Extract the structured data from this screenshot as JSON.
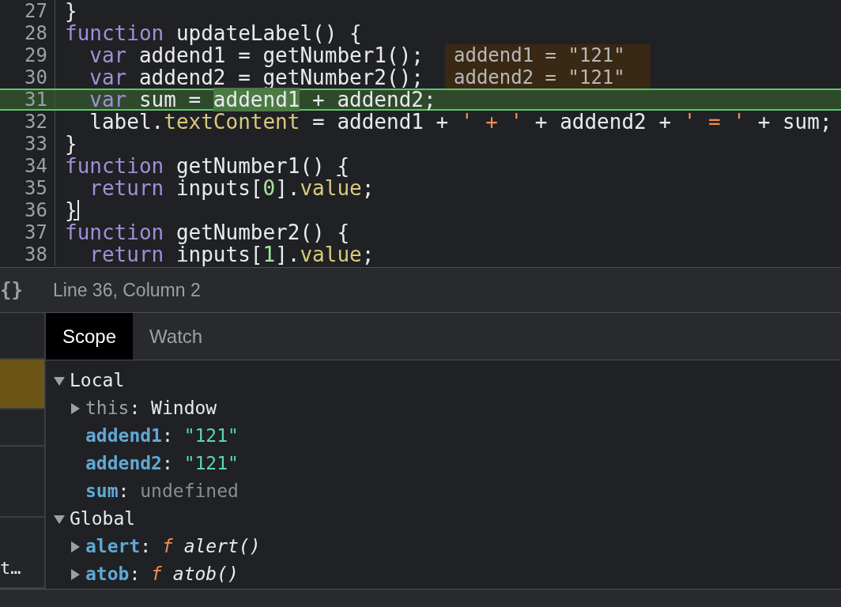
{
  "editor": {
    "lines": [
      {
        "number": "27",
        "current": false,
        "cursor": false,
        "tokens": [
          {
            "kind": "plain",
            "text": "}"
          }
        ]
      },
      {
        "number": "28",
        "current": false,
        "cursor": false,
        "tokens": [
          {
            "kind": "keyword",
            "text": "function"
          },
          {
            "kind": "plain",
            "text": " updateLabel() {"
          }
        ]
      },
      {
        "number": "29",
        "current": false,
        "cursor": false,
        "tokens": [
          {
            "kind": "keyword",
            "text": "  var"
          },
          {
            "kind": "plain",
            "text": " addend1 = getNumber1();"
          }
        ],
        "inline_value": "addend1 = \"121\""
      },
      {
        "number": "30",
        "current": false,
        "cursor": false,
        "tokens": [
          {
            "kind": "keyword",
            "text": "  var"
          },
          {
            "kind": "plain",
            "text": " addend2 = getNumber2();"
          }
        ],
        "inline_value": "addend2 = \"121\""
      },
      {
        "number": "31",
        "current": true,
        "cursor": false,
        "tokens": [
          {
            "kind": "keyword",
            "text": "  var"
          },
          {
            "kind": "plain",
            "text": " sum = "
          },
          {
            "kind": "plain",
            "text": "addend1",
            "hovered": true
          },
          {
            "kind": "plain",
            "text": " + addend2;"
          }
        ]
      },
      {
        "number": "32",
        "current": false,
        "cursor": false,
        "tokens": [
          {
            "kind": "plain",
            "text": "  label."
          },
          {
            "kind": "property",
            "text": "textContent"
          },
          {
            "kind": "plain",
            "text": " = addend1 + "
          },
          {
            "kind": "string",
            "text": "' + '"
          },
          {
            "kind": "plain",
            "text": " + addend2 + "
          },
          {
            "kind": "string",
            "text": "' = '"
          },
          {
            "kind": "plain",
            "text": " + sum;"
          }
        ]
      },
      {
        "number": "33",
        "current": false,
        "cursor": false,
        "tokens": [
          {
            "kind": "plain",
            "text": "}"
          }
        ]
      },
      {
        "number": "34",
        "current": false,
        "cursor": false,
        "tokens": [
          {
            "kind": "keyword",
            "text": "function"
          },
          {
            "kind": "plain",
            "text": " getNumber1() "
          },
          {
            "kind": "plain",
            "text": "{",
            "matched": true
          }
        ]
      },
      {
        "number": "35",
        "current": false,
        "cursor": false,
        "tokens": [
          {
            "kind": "keyword",
            "text": "  return"
          },
          {
            "kind": "plain",
            "text": " inputs["
          },
          {
            "kind": "number",
            "text": "0"
          },
          {
            "kind": "plain",
            "text": "]."
          },
          {
            "kind": "property",
            "text": "value"
          },
          {
            "kind": "plain",
            "text": ";"
          }
        ]
      },
      {
        "number": "36",
        "current": false,
        "cursor": true,
        "tokens": [
          {
            "kind": "plain",
            "text": "}",
            "matched": true
          }
        ]
      },
      {
        "number": "37",
        "current": false,
        "cursor": false,
        "tokens": [
          {
            "kind": "keyword",
            "text": "function"
          },
          {
            "kind": "plain",
            "text": " getNumber2() {"
          }
        ]
      },
      {
        "number": "38",
        "current": false,
        "cursor": false,
        "tokens": [
          {
            "kind": "keyword",
            "text": "  return"
          },
          {
            "kind": "plain",
            "text": " inputs["
          },
          {
            "kind": "number",
            "text": "1"
          },
          {
            "kind": "plain",
            "text": "]."
          },
          {
            "kind": "property",
            "text": "value"
          },
          {
            "kind": "plain",
            "text": ";"
          }
        ]
      }
    ]
  },
  "status_bar": {
    "icon": "{}",
    "position": "Line 36, Column 2"
  },
  "sidebar": {
    "items": [
      {
        "selected": false
      },
      {
        "selected": true
      },
      {
        "selected": false
      },
      {
        "selected": false
      },
      {
        "selected": false,
        "text": "t…"
      }
    ]
  },
  "tabs": [
    {
      "label": "Scope",
      "selected": true
    },
    {
      "label": "Watch",
      "selected": false
    }
  ],
  "scope": [
    {
      "label": "Local",
      "expanded": true,
      "children": [
        {
          "name": "this",
          "colon": ":",
          "kind": "object",
          "value": "Window",
          "expanded": false
        },
        {
          "name": "addend1",
          "colon": ":",
          "kind": "string",
          "value": "\"121\""
        },
        {
          "name": "addend2",
          "colon": ":",
          "kind": "string",
          "value": "\"121\""
        },
        {
          "name": "sum",
          "colon": ":",
          "kind": "undefined",
          "value": "undefined"
        }
      ]
    },
    {
      "label": "Global",
      "expanded": true,
      "children": [
        {
          "name": "alert",
          "colon": ":",
          "kind": "function",
          "mark": "f",
          "value": "alert()",
          "expanded": false
        },
        {
          "name": "atob",
          "colon": ":",
          "kind": "function",
          "mark": "f",
          "value": "atob()",
          "expanded": false
        }
      ]
    }
  ]
}
